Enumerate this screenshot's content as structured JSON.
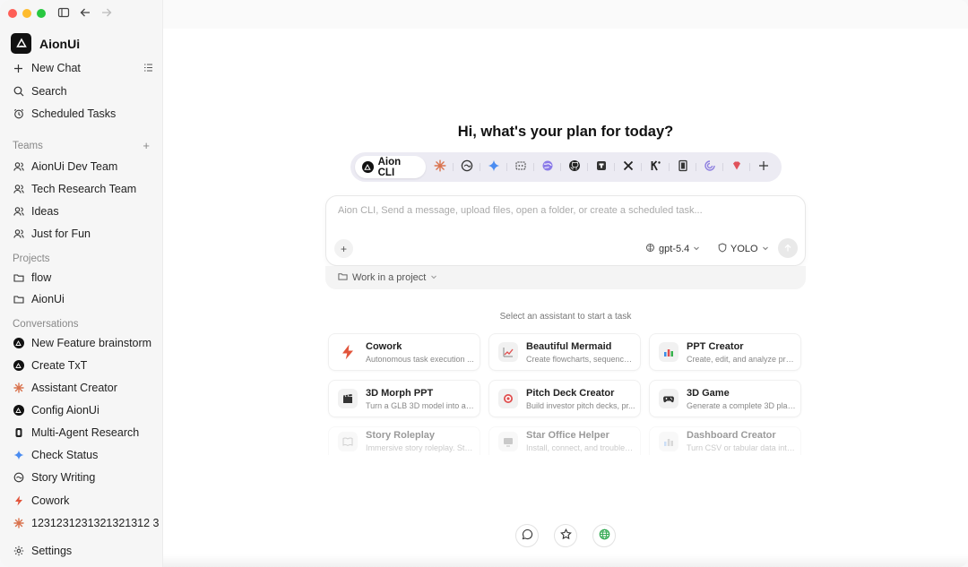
{
  "app": {
    "title": "AionUi"
  },
  "sidebar": {
    "new_chat": "New Chat",
    "search": "Search",
    "scheduled": "Scheduled Tasks",
    "teams_label": "Teams",
    "teams": [
      "AionUi Dev Team",
      "Tech Research Team",
      "Ideas",
      "Just for Fun"
    ],
    "projects_label": "Projects",
    "projects": [
      "flow",
      "AionUi"
    ],
    "conversations_label": "Conversations",
    "conversations": [
      {
        "label": "New Feature brainstorm",
        "icon": "aion-icon"
      },
      {
        "label": "Create TxT",
        "icon": "aion-icon"
      },
      {
        "label": "Assistant Creator",
        "icon": "claude-icon"
      },
      {
        "label": "Config AionUi",
        "icon": "aion-icon"
      },
      {
        "label": "Multi-Agent Research",
        "icon": "agent-icon"
      },
      {
        "label": "Check Status",
        "icon": "gemini-icon"
      },
      {
        "label": "Story Writing",
        "icon": "swirl-icon"
      },
      {
        "label": "Cowork",
        "icon": "bolt-icon"
      },
      {
        "label": "1231231231321321312 3",
        "icon": "claude-icon"
      }
    ],
    "settings": "Settings"
  },
  "main": {
    "greeting": "Hi, what's your plan for today?",
    "active_agent": "Aion CLI",
    "composer_placeholder": "Aion CLI, Send a message, upload files, open a folder, or create a scheduled task...",
    "model": "gpt-5.4",
    "mode": "YOLO",
    "project_selector": "Work in a project",
    "hint": "Select an assistant to start a task",
    "cards": [
      {
        "title": "Cowork",
        "desc": "Autonomous task execution ...",
        "icon": "bolt-icon"
      },
      {
        "title": "Beautiful Mermaid",
        "desc": "Create flowcharts, sequence ...",
        "icon": "chart-line-icon"
      },
      {
        "title": "PPT Creator",
        "desc": "Create, edit, and analyze pro...",
        "icon": "bar-chart-icon"
      },
      {
        "title": "3D Morph PPT",
        "desc": "Turn a GLB 3D model into a c...",
        "icon": "clapper-icon"
      },
      {
        "title": "Pitch Deck Creator",
        "desc": "Build investor pitch decks, pr...",
        "icon": "target-icon"
      },
      {
        "title": "3D Game",
        "desc": "Generate a complete 3D plat...",
        "icon": "gamepad-icon"
      },
      {
        "title": "Story Roleplay",
        "desc": "Immersive story roleplay. Sta...",
        "icon": "book-icon"
      },
      {
        "title": "Star Office Helper",
        "desc": "Install, connect, and troublesh...",
        "icon": "monitor-icon"
      },
      {
        "title": "Dashboard Creator",
        "desc": "Turn CSV or tabular data into...",
        "icon": "bar-chart-icon"
      }
    ]
  }
}
